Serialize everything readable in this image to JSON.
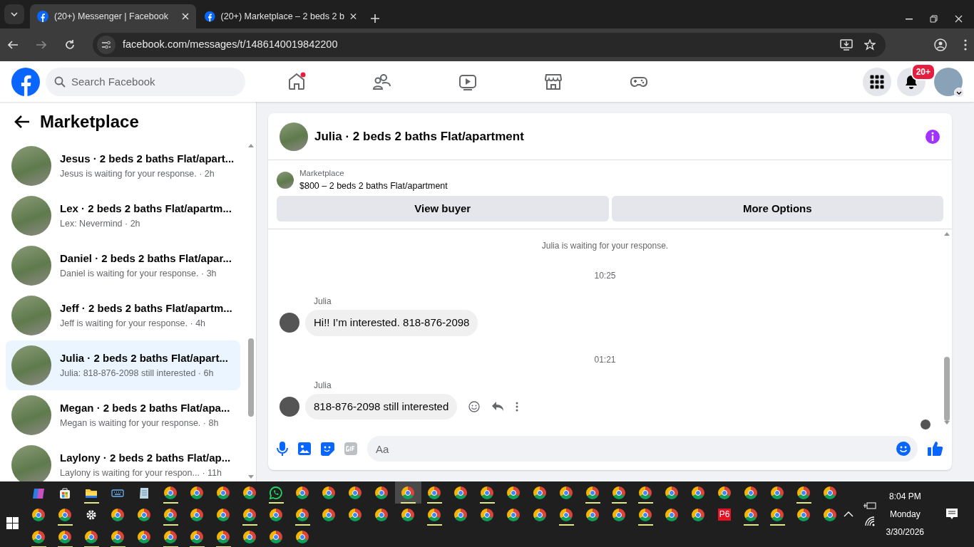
{
  "browser": {
    "tabs": [
      {
        "title": "(20+) Messenger | Facebook",
        "selected": true
      },
      {
        "title": "(20+) Marketplace – 2 beds 2 b",
        "selected": false
      }
    ],
    "url": "facebook.com/messages/t/1486140019842200"
  },
  "header": {
    "search_placeholder": "Search Facebook",
    "nav": [
      {
        "kind": "home",
        "dot": true
      },
      {
        "kind": "friends",
        "dot": false
      },
      {
        "kind": "video",
        "dot": false
      },
      {
        "kind": "marketplace",
        "dot": false
      },
      {
        "kind": "gaming",
        "dot": false
      }
    ],
    "notification_badge": "20+"
  },
  "sidebar": {
    "title": "Marketplace",
    "conversations": [
      {
        "title": "Jesus · 2 beds 2 baths Flat/apart...",
        "preview": "Jesus is waiting for your response. · 2h",
        "selected": false
      },
      {
        "title": "Lex · 2 beds 2 baths Flat/apartm...",
        "preview": "Lex: Nevermind · 2h",
        "selected": false
      },
      {
        "title": "Daniel · 2 beds 2 baths Flat/apar...",
        "preview": "Daniel is waiting for your response. · 3h",
        "selected": false
      },
      {
        "title": "Jeff · 2 beds 2 baths Flat/apartm...",
        "preview": "Jeff is waiting for your response. · 4h",
        "selected": false
      },
      {
        "title": "Julia · 2 beds 2 baths Flat/apart...",
        "preview": "Julia: 818-876-2098 still interested · 6h",
        "selected": true
      },
      {
        "title": "Megan · 2 beds 2 baths Flat/apa...",
        "preview": "Megan is waiting for your response. · 8h",
        "selected": false
      },
      {
        "title": "Laylony · 2 beds 2 baths Flat/ap...",
        "preview": "Laylony is waiting for your respon... · 11h",
        "selected": false
      }
    ]
  },
  "chat": {
    "title": "Julia · 2 beds 2 baths Flat/apartment",
    "listing": {
      "label": "Marketplace",
      "item": "$800 – 2 beds 2 baths Flat/apartment",
      "buttons": [
        "View buyer",
        "More Options"
      ]
    },
    "messages": [
      {
        "kind": "notice",
        "text": "Julia is waiting for your response."
      },
      {
        "kind": "timestamp",
        "text": "10:25"
      },
      {
        "kind": "incoming",
        "sender": "Julia",
        "text": "Hi!! I’m interested. 818-876-2098",
        "hovered": false
      },
      {
        "kind": "timestamp",
        "text": "01:21"
      },
      {
        "kind": "incoming",
        "sender": "Julia",
        "text": "818-876-2098 still interested",
        "hovered": true
      }
    ],
    "composer_placeholder": "Aa"
  },
  "taskbar": {
    "rows": [
      [
        {
          "kind": "copilot",
          "running": false,
          "selected": false
        },
        {
          "kind": "store",
          "running": false,
          "selected": false
        },
        {
          "kind": "explorer",
          "running": true,
          "selected": false
        },
        {
          "kind": "keyboard",
          "running": false,
          "selected": false
        },
        {
          "kind": "notepad",
          "running": false,
          "selected": false
        },
        {
          "kind": "chrome",
          "running": true,
          "selected": false
        },
        {
          "kind": "chrome",
          "running": false,
          "selected": false
        },
        {
          "kind": "chrome",
          "running": false,
          "selected": false
        },
        {
          "kind": "chrome",
          "running": false,
          "selected": false
        },
        {
          "kind": "whatsapp",
          "running": true,
          "selected": false
        },
        {
          "kind": "chrome",
          "running": false,
          "selected": false
        },
        {
          "kind": "chrome",
          "running": false,
          "selected": false
        },
        {
          "kind": "chrome",
          "running": false,
          "selected": false
        },
        {
          "kind": "chrome",
          "running": false,
          "selected": false
        },
        {
          "kind": "chrome",
          "running": true,
          "selected": true
        },
        {
          "kind": "chrome",
          "running": true,
          "selected": false
        },
        {
          "kind": "chrome",
          "running": false,
          "selected": false
        },
        {
          "kind": "chrome",
          "running": true,
          "selected": false
        },
        {
          "kind": "chrome",
          "running": false,
          "selected": false
        },
        {
          "kind": "chrome",
          "running": false,
          "selected": false
        },
        {
          "kind": "chrome",
          "running": false,
          "selected": false
        },
        {
          "kind": "chrome",
          "running": true,
          "selected": false
        },
        {
          "kind": "chrome",
          "running": true,
          "selected": false
        },
        {
          "kind": "chrome",
          "running": true,
          "selected": false
        },
        {
          "kind": "chrome",
          "running": false,
          "selected": false
        },
        {
          "kind": "chrome",
          "running": false,
          "selected": false
        },
        {
          "kind": "chrome",
          "running": false,
          "selected": false
        },
        {
          "kind": "chrome",
          "running": false,
          "selected": false
        },
        {
          "kind": "chrome",
          "running": false,
          "selected": false
        },
        {
          "kind": "chrome",
          "running": true,
          "selected": false
        },
        {
          "kind": "chrome",
          "running": false,
          "selected": false
        }
      ],
      [
        {
          "kind": "chrome",
          "running": false,
          "selected": false
        },
        {
          "kind": "chrome",
          "running": true,
          "selected": false
        },
        {
          "kind": "settings",
          "running": false,
          "selected": false
        },
        {
          "kind": "chrome",
          "running": false,
          "selected": false
        },
        {
          "kind": "chrome",
          "running": false,
          "selected": false
        },
        {
          "kind": "chrome",
          "running": true,
          "selected": false
        },
        {
          "kind": "chrome",
          "running": false,
          "selected": false
        },
        {
          "kind": "chrome",
          "running": false,
          "selected": false
        },
        {
          "kind": "chrome",
          "running": true,
          "selected": false
        },
        {
          "kind": "chrome",
          "running": false,
          "selected": false
        },
        {
          "kind": "chrome",
          "running": true,
          "selected": false
        },
        {
          "kind": "chrome",
          "running": false,
          "selected": false
        },
        {
          "kind": "chrome",
          "running": false,
          "selected": false
        },
        {
          "kind": "chrome",
          "running": false,
          "selected": false
        },
        {
          "kind": "chrome",
          "running": false,
          "selected": false
        },
        {
          "kind": "chrome",
          "running": true,
          "selected": false
        },
        {
          "kind": "chrome",
          "running": false,
          "selected": false
        },
        {
          "kind": "chrome",
          "running": false,
          "selected": false
        },
        {
          "kind": "chrome",
          "running": false,
          "selected": false
        },
        {
          "kind": "chrome",
          "running": false,
          "selected": false
        },
        {
          "kind": "chrome",
          "running": true,
          "selected": false
        },
        {
          "kind": "chrome",
          "running": false,
          "selected": false
        },
        {
          "kind": "chrome",
          "running": false,
          "selected": false
        },
        {
          "kind": "chrome",
          "running": true,
          "selected": false
        },
        {
          "kind": "chrome",
          "running": false,
          "selected": false
        },
        {
          "kind": "chrome",
          "running": false,
          "selected": false
        },
        {
          "kind": "label",
          "label": "P6",
          "running": false,
          "selected": false
        },
        {
          "kind": "chrome",
          "running": true,
          "selected": false
        },
        {
          "kind": "chrome",
          "running": true,
          "selected": false
        },
        {
          "kind": "chrome",
          "running": false,
          "selected": false
        },
        {
          "kind": "chrome",
          "running": false,
          "selected": false
        }
      ],
      [
        {
          "kind": "chrome",
          "running": true,
          "selected": false
        },
        {
          "kind": "chrome",
          "running": true,
          "selected": false
        },
        {
          "kind": "chrome",
          "running": true,
          "selected": false
        },
        {
          "kind": "chrome",
          "running": true,
          "selected": false
        },
        {
          "kind": "chrome",
          "running": false,
          "selected": false
        },
        {
          "kind": "chrome",
          "running": true,
          "selected": false
        },
        {
          "kind": "chrome",
          "running": true,
          "selected": false
        },
        {
          "kind": "chrome",
          "running": true,
          "selected": false
        },
        {
          "kind": "chrome",
          "running": false,
          "selected": false
        },
        {
          "kind": "chrome",
          "running": false,
          "selected": false
        },
        {
          "kind": "chrome",
          "running": false,
          "selected": false
        }
      ]
    ],
    "time": "8:04 PM",
    "day": "Monday",
    "date": "3/30/2026"
  }
}
